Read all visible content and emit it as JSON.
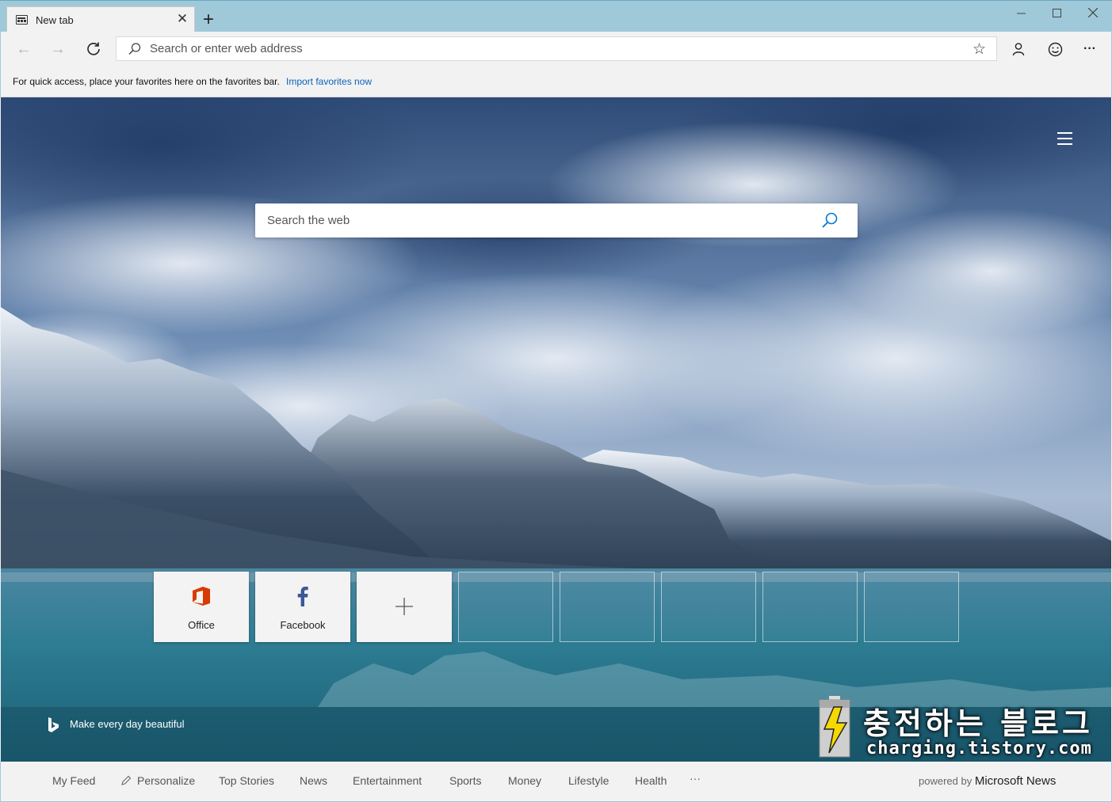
{
  "window": {
    "tab_title": "New tab",
    "new_tab_glyph": "+",
    "tab_close_glyph": "✕",
    "minimize_glyph": "—",
    "maximize_glyph": "☐",
    "close_glyph": "✕"
  },
  "nav": {
    "back_glyph": "←",
    "forward_glyph": "→",
    "address_placeholder": "Search or enter web address",
    "favorite_glyph": "☆",
    "more_glyph": "···"
  },
  "favorites_bar": {
    "message": "For quick access, place your favorites here on the favorites bar.",
    "link": "Import favorites now"
  },
  "newtab": {
    "search_placeholder": "Search the web",
    "tiles": [
      {
        "label": "Office",
        "icon": "office-icon"
      },
      {
        "label": "Facebook",
        "icon": "facebook-icon"
      },
      {
        "label": "",
        "icon": "plus-icon"
      }
    ],
    "empty_tile_count": 5,
    "bing_tagline": "Make every day beautiful"
  },
  "watermark": {
    "title": "충전하는 블로그",
    "url": "charging.tistory.com"
  },
  "bottom_nav": {
    "items": [
      "My Feed",
      "Personalize",
      "Top Stories",
      "News",
      "Entertainment",
      "Sports",
      "Money",
      "Lifestyle",
      "Health"
    ],
    "more_glyph": "···",
    "powered_by_prefix": "powered by",
    "powered_by_brand": "Microsoft News"
  },
  "colors": {
    "titlebar": "#9fc9d9",
    "link": "#0b62b8",
    "office": "#d83b01",
    "facebook": "#3b5998",
    "search_accent": "#0078d7"
  }
}
